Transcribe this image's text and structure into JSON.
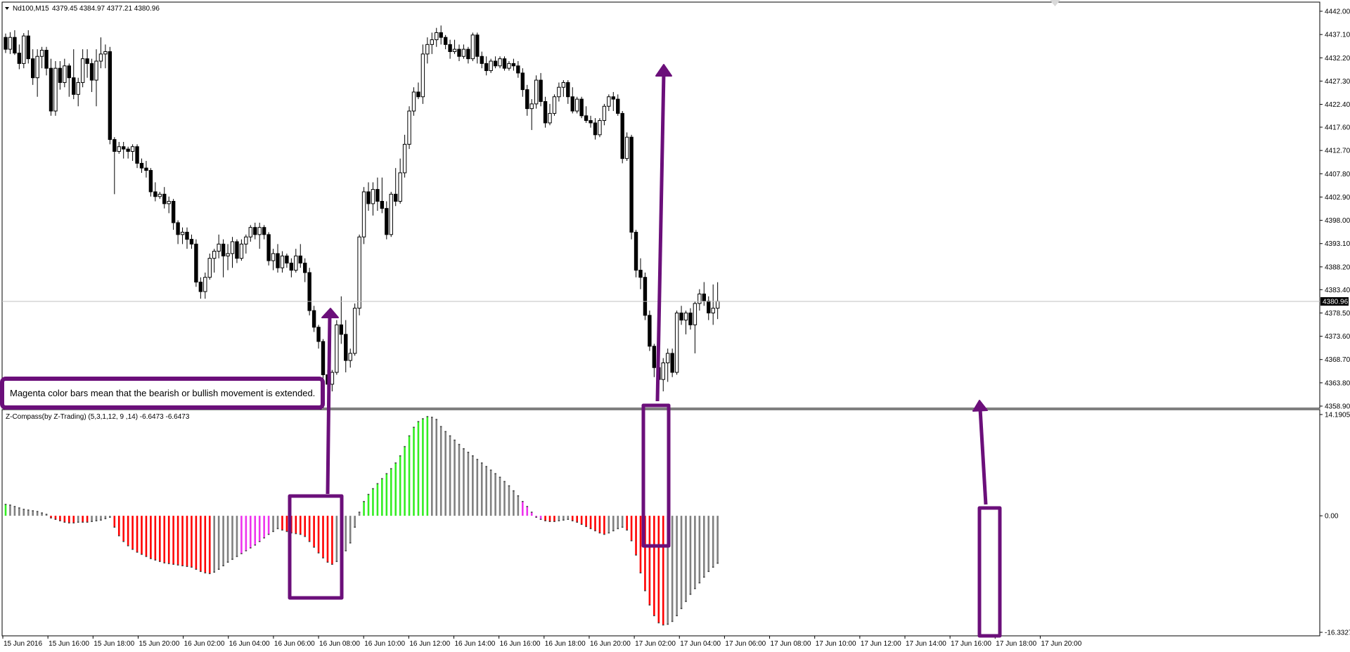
{
  "main_panel": {
    "symbol_label": "Nd100,M15",
    "ohlc_label": "4379.45 4384.97 4377.21 4380.96",
    "current_price": "4380.96",
    "price_ticks": [
      "4442.00",
      "4437.10",
      "4432.20",
      "4427.30",
      "4422.40",
      "4417.60",
      "4412.70",
      "4407.80",
      "4402.90",
      "4398.00",
      "4393.10",
      "4388.20",
      "4383.40",
      "4378.50",
      "4373.60",
      "4368.70",
      "4363.80",
      "4358.90"
    ]
  },
  "indicator_panel": {
    "label": "Z-Compass(by Z-Trading) (5,3,1,12, 9 ,14) -6.6473 -6.6473",
    "top_value": "14.1905",
    "zero_value": "0.00",
    "bottom_value": "-16.3327"
  },
  "time_axis": {
    "labels": [
      "15 Jun 2016",
      "15 Jun 16:00",
      "15 Jun 18:00",
      "15 Jun 20:00",
      "16 Jun 02:00",
      "16 Jun 04:00",
      "16 Jun 06:00",
      "16 Jun 08:00",
      "16 Jun 10:00",
      "16 Jun 12:00",
      "16 Jun 14:00",
      "16 Jun 16:00",
      "16 Jun 18:00",
      "16 Jun 20:00",
      "17 Jun 02:00",
      "17 Jun 04:00",
      "17 Jun 06:00",
      "17 Jun 08:00",
      "17 Jun 10:00",
      "17 Jun 12:00",
      "17 Jun 14:00",
      "17 Jun 16:00",
      "17 Jun 18:00",
      "17 Jun 20:00"
    ]
  },
  "annotation": {
    "callout_text": "Magenta color bars mean that the bearish or bullish movement is extended."
  },
  "colors": {
    "bull_green": "#33ee22",
    "bear_red": "#ff0000",
    "neutral_gray": "#808080",
    "extended_magenta": "#ee33ee",
    "annotation_purple": "#6b0f7a"
  },
  "series": {
    "candles_ohlc": [
      [
        4436.5,
        4437.3,
        4433.2,
        4434.0
      ],
      [
        4434.0,
        4437.6,
        4433.0,
        4436.5
      ],
      [
        4436.5,
        4438.0,
        4432.8,
        4433.2
      ],
      [
        4433.2,
        4435.0,
        4429.8,
        4431.0
      ],
      [
        4431.0,
        4437.4,
        4430.0,
        4436.8
      ],
      [
        4436.8,
        4438.0,
        4431.0,
        4432.0
      ],
      [
        4432.0,
        4434.0,
        4426.5,
        4428.0
      ],
      [
        4428.0,
        4434.0,
        4424.0,
        4432.5
      ],
      [
        4432.5,
        4434.5,
        4430.0,
        4433.8
      ],
      [
        4433.8,
        4434.5,
        4428.5,
        4430.0
      ],
      [
        4430.0,
        4432.0,
        4420.0,
        4421.0
      ],
      [
        4421.0,
        4431.5,
        4420.0,
        4430.0
      ],
      [
        4430.0,
        4431.5,
        4425.5,
        4427.0
      ],
      [
        4427.0,
        4432.0,
        4426.0,
        4430.5
      ],
      [
        4430.5,
        4431.0,
        4424.0,
        4428.0
      ],
      [
        4428.0,
        4434.0,
        4423.5,
        4424.5
      ],
      [
        4424.5,
        4428.0,
        4422.0,
        4427.0
      ],
      [
        4427.0,
        4434.0,
        4426.0,
        4432.0
      ],
      [
        4432.0,
        4434.0,
        4428.0,
        4431.0
      ],
      [
        4431.0,
        4432.0,
        4425.0,
        4427.5
      ],
      [
        4427.5,
        4434.0,
        4422.0,
        4431.5
      ],
      [
        4431.5,
        4436.5,
        4430.0,
        4433.0
      ],
      [
        4433.0,
        4435.0,
        4430.0,
        4433.5
      ],
      [
        4433.5,
        4434.5,
        4414.0,
        4415.0
      ],
      [
        4415.0,
        4415.5,
        4403.5,
        4412.5
      ],
      [
        4412.5,
        4414.5,
        4412.0,
        4413.5
      ],
      [
        4413.5,
        4414.5,
        4411.0,
        4413.0
      ],
      [
        4413.0,
        4413.5,
        4411.0,
        4412.5
      ],
      [
        4412.5,
        4414.0,
        4410.5,
        4413.5
      ],
      [
        4413.5,
        4414.0,
        4409.0,
        4410.0
      ],
      [
        4410.0,
        4411.0,
        4408.0,
        4409.0
      ],
      [
        4409.0,
        4410.5,
        4407.0,
        4408.5
      ],
      [
        4408.5,
        4409.0,
        4403.0,
        4404.0
      ],
      [
        4404.0,
        4406.0,
        4402.0,
        4403.0
      ],
      [
        4403.0,
        4404.0,
        4402.5,
        4403.5
      ],
      [
        4403.5,
        4405.0,
        4400.5,
        4401.5
      ],
      [
        4401.5,
        4403.0,
        4399.5,
        4402.0
      ],
      [
        4402.0,
        4402.5,
        4396.0,
        4397.5
      ],
      [
        4397.5,
        4398.0,
        4393.0,
        4395.0
      ],
      [
        4395.0,
        4396.5,
        4393.0,
        4395.5
      ],
      [
        4395.5,
        4396.5,
        4392.0,
        4394.0
      ],
      [
        4394.0,
        4395.0,
        4392.0,
        4393.0
      ],
      [
        4393.0,
        4394.0,
        4384.0,
        4385.0
      ],
      [
        4385.0,
        4386.0,
        4381.5,
        4383.0
      ],
      [
        4383.0,
        4387.0,
        4381.5,
        4386.0
      ],
      [
        4386.0,
        4391.0,
        4385.5,
        4390.0
      ],
      [
        4390.0,
        4392.0,
        4387.0,
        4391.5
      ],
      [
        4391.5,
        4395.0,
        4390.0,
        4393.0
      ],
      [
        4393.0,
        4394.0,
        4386.0,
        4390.5
      ],
      [
        4390.5,
        4393.0,
        4387.5,
        4391.0
      ],
      [
        4391.0,
        4394.5,
        4388.0,
        4393.5
      ],
      [
        4393.5,
        4394.0,
        4389.0,
        4390.0
      ],
      [
        4390.0,
        4394.0,
        4389.5,
        4393.0
      ],
      [
        4393.0,
        4395.0,
        4391.0,
        4394.5
      ],
      [
        4394.5,
        4397.0,
        4393.5,
        4396.5
      ],
      [
        4396.5,
        4397.5,
        4394.0,
        4395.0
      ],
      [
        4395.0,
        4397.5,
        4392.0,
        4396.5
      ],
      [
        4396.5,
        4397.0,
        4394.0,
        4395.0
      ],
      [
        4395.0,
        4395.5,
        4388.5,
        4389.5
      ],
      [
        4389.5,
        4392.0,
        4387.5,
        4391.0
      ],
      [
        4391.0,
        4393.0,
        4387.0,
        4388.0
      ],
      [
        4388.0,
        4391.5,
        4387.0,
        4390.5
      ],
      [
        4390.5,
        4391.0,
        4388.0,
        4389.0
      ],
      [
        4389.0,
        4390.0,
        4386.0,
        4387.5
      ],
      [
        4387.5,
        4392.0,
        4387.0,
        4390.5
      ],
      [
        4390.5,
        4393.0,
        4388.0,
        4389.0
      ],
      [
        4389.0,
        4390.0,
        4385.0,
        4387.0
      ],
      [
        4387.0,
        4388.0,
        4378.0,
        4379.0
      ],
      [
        4379.0,
        4380.0,
        4374.5,
        4375.5
      ],
      [
        4375.5,
        4376.0,
        4371.0,
        4372.5
      ],
      [
        4372.5,
        4373.0,
        4364.0,
        4365.5
      ],
      [
        4365.5,
        4366.5,
        4362.5,
        4363.5
      ],
      [
        4363.5,
        4366.5,
        4362.0,
        4366.0
      ],
      [
        4366.0,
        4377.0,
        4365.5,
        4376.0
      ],
      [
        4376.0,
        4382.0,
        4372.0,
        4374.0
      ],
      [
        4374.0,
        4377.0,
        4366.0,
        4368.5
      ],
      [
        4368.5,
        4371.0,
        4367.0,
        4370.0
      ],
      [
        4370.0,
        4380.5,
        4369.5,
        4379.5
      ],
      [
        4379.5,
        4395.0,
        4378.0,
        4394.5
      ],
      [
        4394.5,
        4405.0,
        4393.0,
        4404.0
      ],
      [
        4404.0,
        4406.0,
        4400.0,
        4401.5
      ],
      [
        4401.5,
        4406.0,
        4399.0,
        4404.5
      ],
      [
        4404.5,
        4407.0,
        4400.0,
        4402.0
      ],
      [
        4402.0,
        4407.0,
        4399.5,
        4400.5
      ],
      [
        4400.5,
        4402.0,
        4394.0,
        4395.0
      ],
      [
        4395.0,
        4404.0,
        4394.5,
        4403.5
      ],
      [
        4403.5,
        4409.0,
        4401.0,
        4402.0
      ],
      [
        4402.0,
        4411.0,
        4401.5,
        4408.0
      ],
      [
        4408.0,
        4416.0,
        4407.0,
        4414.0
      ],
      [
        4414.0,
        4422.0,
        4413.0,
        4421.0
      ],
      [
        4421.0,
        4426.0,
        4420.0,
        4425.0
      ],
      [
        4425.0,
        4427.0,
        4423.5,
        4424.0
      ],
      [
        4424.0,
        4435.0,
        4422.5,
        4433.0
      ],
      [
        4433.0,
        4436.5,
        4431.0,
        4435.0
      ],
      [
        4435.0,
        4437.5,
        4433.0,
        4436.0
      ],
      [
        4436.0,
        4438.5,
        4434.5,
        4437.5
      ],
      [
        4437.5,
        4439.0,
        4435.0,
        4436.5
      ],
      [
        4436.5,
        4437.0,
        4434.0,
        4435.0
      ],
      [
        4435.0,
        4436.0,
        4432.0,
        4433.5
      ],
      [
        4433.5,
        4436.0,
        4433.0,
        4434.0
      ],
      [
        4434.0,
        4435.0,
        4431.5,
        4432.5
      ],
      [
        4432.5,
        4435.0,
        4432.0,
        4434.0
      ],
      [
        4434.0,
        4434.5,
        4431.0,
        4432.0
      ],
      [
        4432.0,
        4437.5,
        4431.5,
        4437.0
      ],
      [
        4437.0,
        4437.5,
        4431.0,
        4432.5
      ],
      [
        4432.5,
        4433.5,
        4430.0,
        4431.0
      ],
      [
        4431.0,
        4432.5,
        4428.5,
        4429.5
      ],
      [
        4429.5,
        4432.0,
        4429.0,
        4431.5
      ],
      [
        4431.5,
        4432.5,
        4430.0,
        4430.5
      ],
      [
        4430.5,
        4432.5,
        4430.0,
        4432.0
      ],
      [
        4432.0,
        4432.5,
        4429.5,
        4430.0
      ],
      [
        4430.0,
        4431.5,
        4429.5,
        4431.0
      ],
      [
        4431.0,
        4432.0,
        4429.5,
        4430.5
      ],
      [
        4430.5,
        4431.5,
        4428.0,
        4429.0
      ],
      [
        4429.0,
        4430.0,
        4424.0,
        4425.5
      ],
      [
        4425.5,
        4426.5,
        4420.0,
        4421.5
      ],
      [
        4421.5,
        4423.5,
        4417.0,
        4422.5
      ],
      [
        4422.5,
        4428.5,
        4421.5,
        4427.5
      ],
      [
        4427.5,
        4429.0,
        4422.0,
        4423.0
      ],
      [
        4423.0,
        4424.0,
        4417.5,
        4418.5
      ],
      [
        4418.5,
        4422.5,
        4418.0,
        4420.5
      ],
      [
        4420.5,
        4424.5,
        4420.0,
        4424.0
      ],
      [
        4424.0,
        4427.0,
        4423.0,
        4426.0
      ],
      [
        4426.0,
        4427.5,
        4424.0,
        4427.0
      ],
      [
        4427.0,
        4427.5,
        4422.5,
        4424.0
      ],
      [
        4424.0,
        4426.0,
        4420.5,
        4421.0
      ],
      [
        4421.0,
        4424.0,
        4420.5,
        4423.5
      ],
      [
        4423.5,
        4424.0,
        4419.5,
        4420.0
      ],
      [
        4420.0,
        4422.0,
        4418.5,
        4419.0
      ],
      [
        4419.0,
        4420.0,
        4417.5,
        4418.5
      ],
      [
        4418.5,
        4419.5,
        4415.0,
        4416.0
      ],
      [
        4416.0,
        4419.5,
        4415.5,
        4419.0
      ],
      [
        4419.0,
        4422.5,
        4418.0,
        4422.0
      ],
      [
        4422.0,
        4424.5,
        4421.0,
        4424.0
      ],
      [
        4424.0,
        4425.0,
        4421.0,
        4423.5
      ],
      [
        4423.5,
        4424.5,
        4420.0,
        4420.5
      ],
      [
        4420.5,
        4421.0,
        4410.0,
        4411.0
      ],
      [
        4411.0,
        4416.5,
        4410.5,
        4415.5
      ],
      [
        4415.5,
        4416.0,
        4394.0,
        4395.5
      ],
      [
        4395.5,
        4396.0,
        4386.0,
        4387.5
      ],
      [
        4387.5,
        4390.0,
        4383.5,
        4386.0
      ],
      [
        4386.0,
        4387.0,
        4377.0,
        4378.0
      ],
      [
        4378.0,
        4379.0,
        4370.5,
        4371.5
      ],
      [
        4371.5,
        4372.0,
        4365.0,
        4367.0
      ],
      [
        4367.0,
        4368.0,
        4363.5,
        4364.5
      ],
      [
        4364.5,
        4369.0,
        4362.0,
        4368.0
      ],
      [
        4368.0,
        4371.0,
        4364.0,
        4370.0
      ],
      [
        4370.0,
        4371.0,
        4365.0,
        4366.0
      ],
      [
        4366.0,
        4379.0,
        4365.5,
        4378.5
      ],
      [
        4378.5,
        4380.0,
        4376.0,
        4377.0
      ],
      [
        4377.0,
        4379.0,
        4374.0,
        4378.5
      ],
      [
        4378.5,
        4379.5,
        4375.0,
        4376.0
      ],
      [
        4376.0,
        4381.0,
        4370.0,
        4380.5
      ],
      [
        4380.5,
        4383.5,
        4379.0,
        4382.5
      ],
      [
        4382.5,
        4385.0,
        4380.0,
        4381.0
      ],
      [
        4381.0,
        4382.0,
        4377.0,
        4378.5
      ],
      [
        4378.5,
        4384.5,
        4376.0,
        4379.5
      ],
      [
        4379.5,
        4384.97,
        4377.21,
        4380.96
      ]
    ],
    "indicator_values": [
      1.6,
      1.5,
      1.3,
      1.1,
      0.9,
      0.8,
      0.7,
      0.6,
      0.4,
      0.2,
      -0.3,
      -0.5,
      -0.7,
      -0.9,
      -1.0,
      -1.0,
      -0.9,
      -0.9,
      -0.9,
      -0.8,
      -0.7,
      -0.6,
      -0.4,
      -0.2,
      -1.6,
      -2.8,
      -3.6,
      -4.2,
      -4.7,
      -5.1,
      -5.4,
      -5.7,
      -6.0,
      -6.2,
      -6.4,
      -6.6,
      -6.7,
      -6.8,
      -6.9,
      -7.0,
      -7.1,
      -7.2,
      -7.5,
      -7.8,
      -8.0,
      -8.1,
      -7.9,
      -7.5,
      -7.0,
      -6.5,
      -6.1,
      -5.7,
      -5.3,
      -4.9,
      -4.5,
      -4.1,
      -3.6,
      -3.1,
      -2.6,
      -2.2,
      -1.8,
      -2.0,
      -2.2,
      -2.4,
      -2.5,
      -2.6,
      -2.9,
      -3.6,
      -4.4,
      -5.2,
      -5.9,
      -6.5,
      -6.8,
      -6.4,
      -5.8,
      -4.9,
      -3.8,
      -1.6,
      0.5,
      2.0,
      3.0,
      3.8,
      4.5,
      5.2,
      5.9,
      6.6,
      7.4,
      8.4,
      9.7,
      11.2,
      12.4,
      13.2,
      13.6,
      13.9,
      13.8,
      13.5,
      12.5,
      11.8,
      11.2,
      10.6,
      10.0,
      9.4,
      8.9,
      8.4,
      7.9,
      7.4,
      6.9,
      6.4,
      5.9,
      5.4,
      4.8,
      4.2,
      3.5,
      2.8,
      2.0,
      1.3,
      0.5,
      -0.2,
      -0.5,
      -0.7,
      -0.8,
      -0.8,
      -0.7,
      -0.6,
      -0.5,
      -0.7,
      -0.9,
      -1.2,
      -1.5,
      -1.8,
      -2.1,
      -2.4,
      -2.6,
      -2.4,
      -2.1,
      -1.8,
      -1.6,
      -2.0,
      -3.5,
      -5.5,
      -8.0,
      -10.5,
      -12.5,
      -14.0,
      -15.0,
      -15.3,
      -15.2,
      -14.8,
      -14.0,
      -13.0,
      -12.0,
      -11.0,
      -10.2,
      -9.4,
      -8.6,
      -7.8,
      -7.2,
      -6.6473
    ]
  }
}
